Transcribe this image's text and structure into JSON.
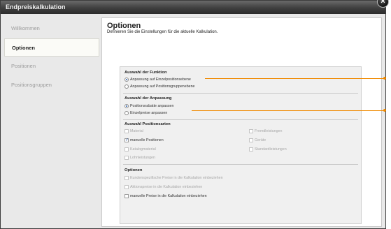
{
  "window": {
    "title": "Endpreiskalkulation",
    "close_glyph": "×"
  },
  "sidebar": {
    "items": [
      {
        "label": "Willkommen",
        "active": false
      },
      {
        "label": "Optionen",
        "active": true
      },
      {
        "label": "Positionen",
        "active": false
      },
      {
        "label": "Positionsgruppen",
        "active": false
      }
    ]
  },
  "content": {
    "title": "Optionen",
    "subtitle": "Definieren Sie die Einstellungen für die aktuelle Kalkulation."
  },
  "funktion": {
    "heading": "Auswahl der Funktion",
    "options": [
      {
        "label": "Anpassung auf Einzelpositionsebene",
        "selected": true
      },
      {
        "label": "Anpassung auf Positionsgruppenebene",
        "selected": false
      }
    ]
  },
  "anpassung": {
    "heading": "Auswahl der Anpassung",
    "options": [
      {
        "label": "Positionsrabatte anpassen",
        "selected": true
      },
      {
        "label": "Einzelpreise anpassen",
        "selected": false
      }
    ]
  },
  "positionsarten": {
    "heading": "Auswahl Positionsarten",
    "left": [
      {
        "label": "Material",
        "checked": false,
        "enabled": false
      },
      {
        "label": "manuelle Positionen",
        "checked": true,
        "enabled": true
      },
      {
        "label": "Katalogmaterial",
        "checked": false,
        "enabled": false
      },
      {
        "label": "Lohnleistungen",
        "checked": false,
        "enabled": false
      }
    ],
    "right": [
      {
        "label": "Fremdleistungen",
        "checked": false,
        "enabled": false
      },
      {
        "label": "Geräte",
        "checked": false,
        "enabled": false
      },
      {
        "label": "Standardleistungen",
        "checked": false,
        "enabled": false
      }
    ]
  },
  "optionen": {
    "heading": "Optionen",
    "items": [
      {
        "label": "Kundenspezifische Preise in die Kalkulation einbeziehen",
        "checked": false,
        "enabled": false
      },
      {
        "label": "Aktionspreise in die Kalkulation einbeziehen",
        "checked": false,
        "enabled": false
      },
      {
        "label": "manuelle Preise in die Kalkulation einbeziehen",
        "checked": false,
        "enabled": true
      }
    ]
  },
  "colors": {
    "callout": "#f08a00",
    "titlebar": "#3f3f3f",
    "accent": "#2a5fb0"
  }
}
